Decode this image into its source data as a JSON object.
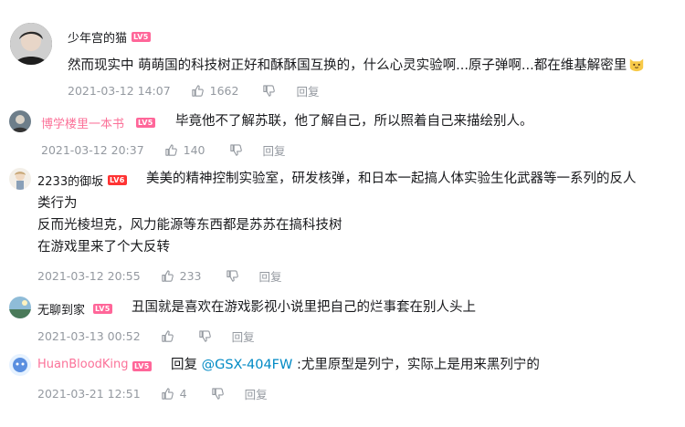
{
  "comments": [
    {
      "user": "少年宫的猫",
      "level": "LV5",
      "lines": [
        "然而现实中 萌萌国的科技树正好和酥酥国互换的，什么心灵实验啊...原子弹啊...都在维基解密里"
      ],
      "emoji": "cat-face-emoji",
      "time": "2021-03-12 14:07",
      "likes": "1662",
      "reply_label": "回复"
    },
    {
      "user": "博学楼里一本书",
      "level": "LV5",
      "lines": [
        "毕竟他不了解苏联，他了解自己，所以照着自己来描绘别人。"
      ],
      "time": "2021-03-12 20:37",
      "likes": "140",
      "reply_label": "回复"
    },
    {
      "user": "2233的御坂",
      "level": "LV6",
      "lines": [
        "美美的精神控制实验室，研发核弹，和日本一起搞人体实验生化武器等一系列的反人",
        "类行为",
        "反而光棱坦克，风力能源等东西都是苏苏在搞科技树",
        "在游戏里来了个大反转"
      ],
      "time": "2021-03-12 20:55",
      "likes": "233",
      "reply_label": "回复"
    },
    {
      "user": "无聊到家",
      "level": "LV5",
      "lines": [
        "丑国就是喜欢在游戏影视小说里把自己的烂事套在别人头上"
      ],
      "time": "2021-03-13 00:52",
      "likes": "",
      "reply_label": "回复"
    },
    {
      "user": "HuanBloodKing",
      "level": "LV5",
      "reply_prefix": "回复 ",
      "mention": "@GSX-404FW",
      "text_after": " :尤里原型是列宁，实际上是用来黑列宁的",
      "time": "2021-03-21 12:51",
      "likes": "4",
      "reply_label": "回复"
    }
  ],
  "colors": {
    "lv5": "#ff6699",
    "lv6": "#ff3333",
    "username_pink": "#fb7299",
    "mention": "#008ac5",
    "meta_gray": "#9499a0"
  }
}
